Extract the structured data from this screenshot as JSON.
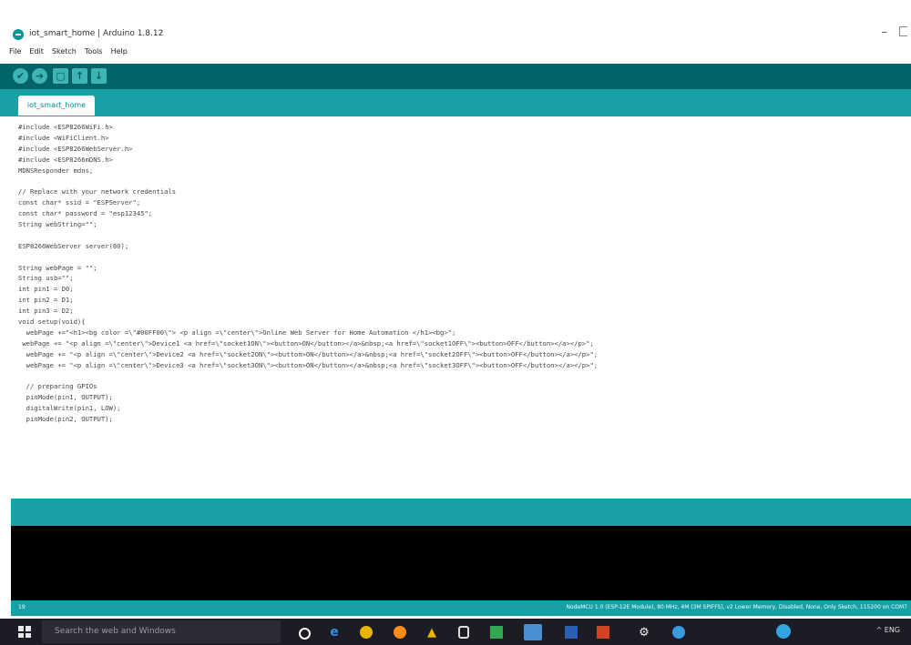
{
  "window": {
    "title": "iot_smart_home | Arduino 1.8.12",
    "minimize_glyph": "–"
  },
  "menu": [
    "File",
    "Edit",
    "Sketch",
    "Tools",
    "Help"
  ],
  "toolbar": {
    "verify_glyph": "✔",
    "upload_glyph": "➔",
    "new_glyph": "▢",
    "open_glyph": "↑",
    "save_glyph": "↓"
  },
  "tab": {
    "label": "iot_smart_home"
  },
  "code_lines": [
    "#include <ESP8266WiFi.h>",
    "#include <WiFiClient.h>",
    "#include <ESP8266WebServer.h>",
    "#include <ESP8266mDNS.h>",
    "MDNSResponder mdns;",
    "",
    "// Replace with your network credentials",
    "const char* ssid = \"ESPServer\";",
    "const char* password = \"esp12345\";",
    "String webString=\"\";",
    "",
    "ESP8266WebServer server(80);",
    "",
    "String webPage = \"\";",
    "String usb=\"\";",
    "int pin1 = D0;",
    "int pin2 = D1;",
    "int pin3 = D2;",
    "void setup(void){",
    "  webPage +=\"<h1><bg color =\\\"#00FF00\\\"> <p align =\\\"center\\\">Online Web Server for Home Automation </h1><bg>\";",
    " webPage += \"<p align =\\\"center\\\">Device1 <a href=\\\"socket1ON\\\"><button>ON</button></a>&nbsp;<a href=\\\"socket1OFF\\\"><button>OFF</button></a></p>\";",
    "  webPage += \"<p align =\\\"center\\\">Device2 <a href=\\\"socket2ON\\\"><button>ON</button></a>&nbsp;<a href=\\\"socket2OFF\\\"><button>OFF</button></a></p>\";",
    "  webPage += \"<p align =\\\"center\\\">Device3 <a href=\\\"socket3ON\\\"><button>ON</button></a>&nbsp;<a href=\\\"socket3OFF\\\"><button>OFF</button></a></p>\";",
    "",
    "  // preparing GPIOs",
    "  pinMode(pin1, OUTPUT);",
    "  digitalWrite(pin1, LOW);",
    "  pinMode(pin2, OUTPUT);"
  ],
  "status": {
    "line_number": "19",
    "board_info": "NodeMCU 1.0 (ESP-12E Module), 80 MHz, 4M (3M SPIFFS), v2 Lower Memory, Disabled, None, Only Sketch, 115200 on COM7"
  },
  "taskbar": {
    "search_placeholder": "Search the web and Windows",
    "tray_text": "^ ENG"
  },
  "colors": {
    "toolbar": "#006468",
    "tabbar": "#17a1a5",
    "console": "#000000",
    "taskbar": "#1c1c24"
  }
}
